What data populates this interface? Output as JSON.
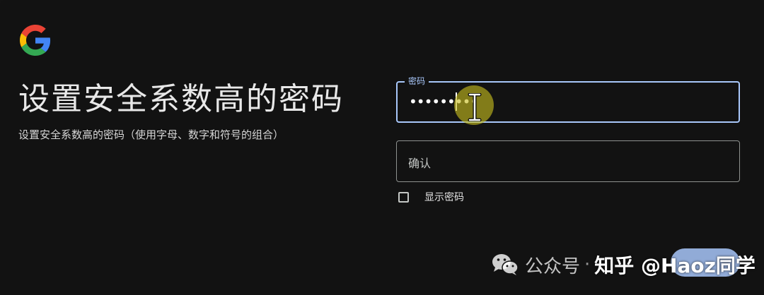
{
  "brand": {
    "logo_icon": "google-g-logo-icon",
    "colors": {
      "blue": "#4285F4",
      "red": "#EA4335",
      "yellow": "#FBBC05",
      "green": "#34A853"
    }
  },
  "header": {
    "title": "设置安全系数高的密码",
    "subtitle": "设置安全系数高的密码（使用字母、数字和符号的组合）"
  },
  "form": {
    "password": {
      "label": "密码",
      "value": "•••••••••"
    },
    "confirm": {
      "placeholder": "确认"
    },
    "show_password": {
      "label": "显示密码",
      "checked": false
    },
    "next_button": {
      "label": ""
    }
  },
  "watermark": {
    "account_prefix": "公众号",
    "separator": "·",
    "platform": "知乎",
    "handle": "知乎 @Haoz同学"
  },
  "theme": {
    "background": "#121212",
    "focus_color": "#a8c7fa",
    "cursor_highlight": "#c8be1e"
  }
}
